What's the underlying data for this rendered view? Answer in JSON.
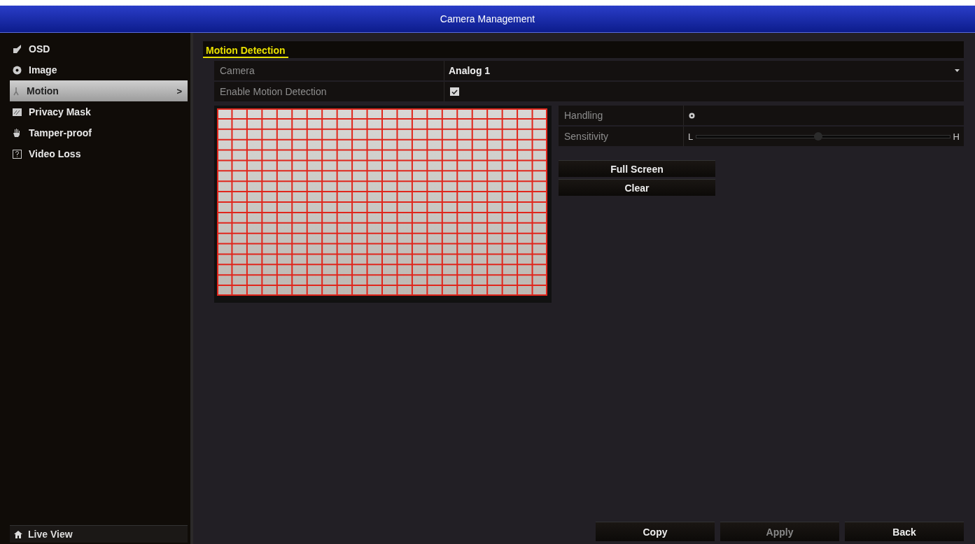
{
  "window": {
    "title": "Camera Management"
  },
  "sidebar": {
    "items": [
      {
        "label": "OSD",
        "kind": "osd",
        "selected": false
      },
      {
        "label": "Image",
        "kind": "image",
        "selected": false
      },
      {
        "label": "Motion",
        "kind": "motion",
        "selected": true,
        "arrow": ">"
      },
      {
        "label": "Privacy Mask",
        "kind": "mask",
        "selected": false
      },
      {
        "label": "Tamper-proof",
        "kind": "hand",
        "selected": false
      },
      {
        "label": "Video Loss",
        "kind": "loss",
        "selected": false
      }
    ],
    "footer": {
      "label": "Live View"
    }
  },
  "section": {
    "title": "Motion Detection"
  },
  "fields": [
    {
      "kind": "select",
      "label": "Camera",
      "value": "Analog 1"
    },
    {
      "kind": "checkbox",
      "label": "Enable Motion Detection",
      "checked": true
    }
  ],
  "settings": [
    {
      "kind": "icon",
      "label": "Handling"
    },
    {
      "kind": "slider",
      "label": "Sensitivity",
      "low": "L",
      "high": "H",
      "level": 0.48
    }
  ],
  "actions": [
    {
      "label": "Full Screen"
    },
    {
      "label": "Clear"
    }
  ],
  "footer_buttons": [
    {
      "label": "Copy",
      "disabled": false
    },
    {
      "label": "Apply",
      "disabled": true
    },
    {
      "label": "Back",
      "disabled": false
    }
  ]
}
